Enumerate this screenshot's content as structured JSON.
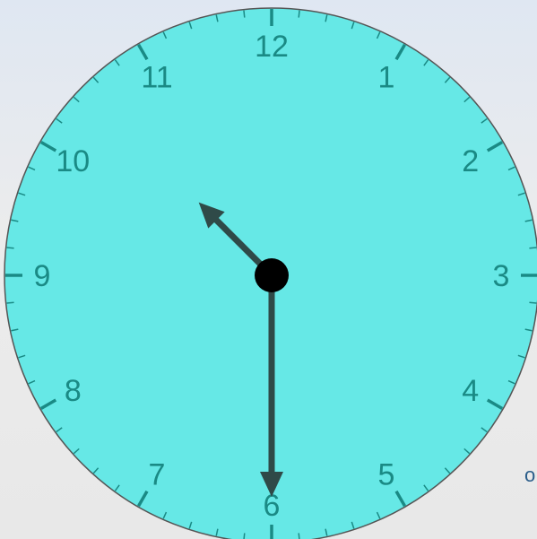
{
  "clock": {
    "numerals": [
      "12",
      "1",
      "2",
      "3",
      "4",
      "5",
      "6",
      "7",
      "8",
      "9",
      "10",
      "11"
    ],
    "hour_hand_points_to": 10.5,
    "minute_hand_points_to_minute": 30,
    "face_color": "#66e8e6",
    "numeral_color": "#1a8a85",
    "tick_color": "#1a8a85",
    "hand_color": "#2f4a48",
    "center_color": "#000000",
    "rim_color": "#555555"
  },
  "edge_mark": {
    "text": "o",
    "color": "#2a5d8a"
  }
}
